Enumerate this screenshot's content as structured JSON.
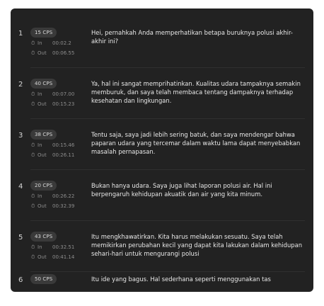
{
  "segments": [
    {
      "num": "1",
      "cps": "15 CPS",
      "in_label": "In",
      "in_time": "00:02.2",
      "out_label": "Out",
      "out_time": "00:06.55",
      "text": "Hei, pernahkah Anda memperhatikan betapa buruknya polusi akhir-akhir ini?"
    },
    {
      "num": "2",
      "cps": "40 CPS",
      "in_label": "In",
      "in_time": "00:07.00",
      "out_label": "Out",
      "out_time": "00:15.23",
      "text": "Ya, hal ini sangat memprihatinkan. Kualitas udara tampaknya semakin memburuk, dan saya telah membaca tentang dampaknya terhadap kesehatan dan lingkungan."
    },
    {
      "num": "3",
      "cps": "38 CPS",
      "in_label": "In",
      "in_time": "00:15.46",
      "out_label": "Out",
      "out_time": "00:26.11",
      "text": "Tentu saja, saya jadi lebih sering batuk, dan saya mendengar bahwa paparan udara yang tercemar dalam waktu lama dapat menyebabkan masalah pernapasan."
    },
    {
      "num": "4",
      "cps": "20 CPS",
      "in_label": "In",
      "in_time": "00:26.22",
      "out_label": "Out",
      "out_time": "00:32.39",
      "text": "Bukan hanya udara. Saya juga lihat laporan polusi air. Hal ini berpengaruh kehidupan akuatik dan air yang kita minum."
    },
    {
      "num": "5",
      "cps": "43 CPS",
      "in_label": "In",
      "in_time": "00:32.51",
      "out_label": "Out",
      "out_time": "00:41.14",
      "text": "Itu mengkhawatirkan. Kita harus melakukan sesuatu. Saya telah memikirkan perubahan kecil yang dapat kita lakukan dalam kehidupan sehari-hari untuk mengurangi polusi"
    },
    {
      "num": "6",
      "cps": "50 CPS",
      "in_label": "",
      "in_time": "",
      "out_label": "",
      "out_time": "",
      "text": "Itu ide yang bagus. Hal sederhana seperti menggunakan tas"
    }
  ]
}
